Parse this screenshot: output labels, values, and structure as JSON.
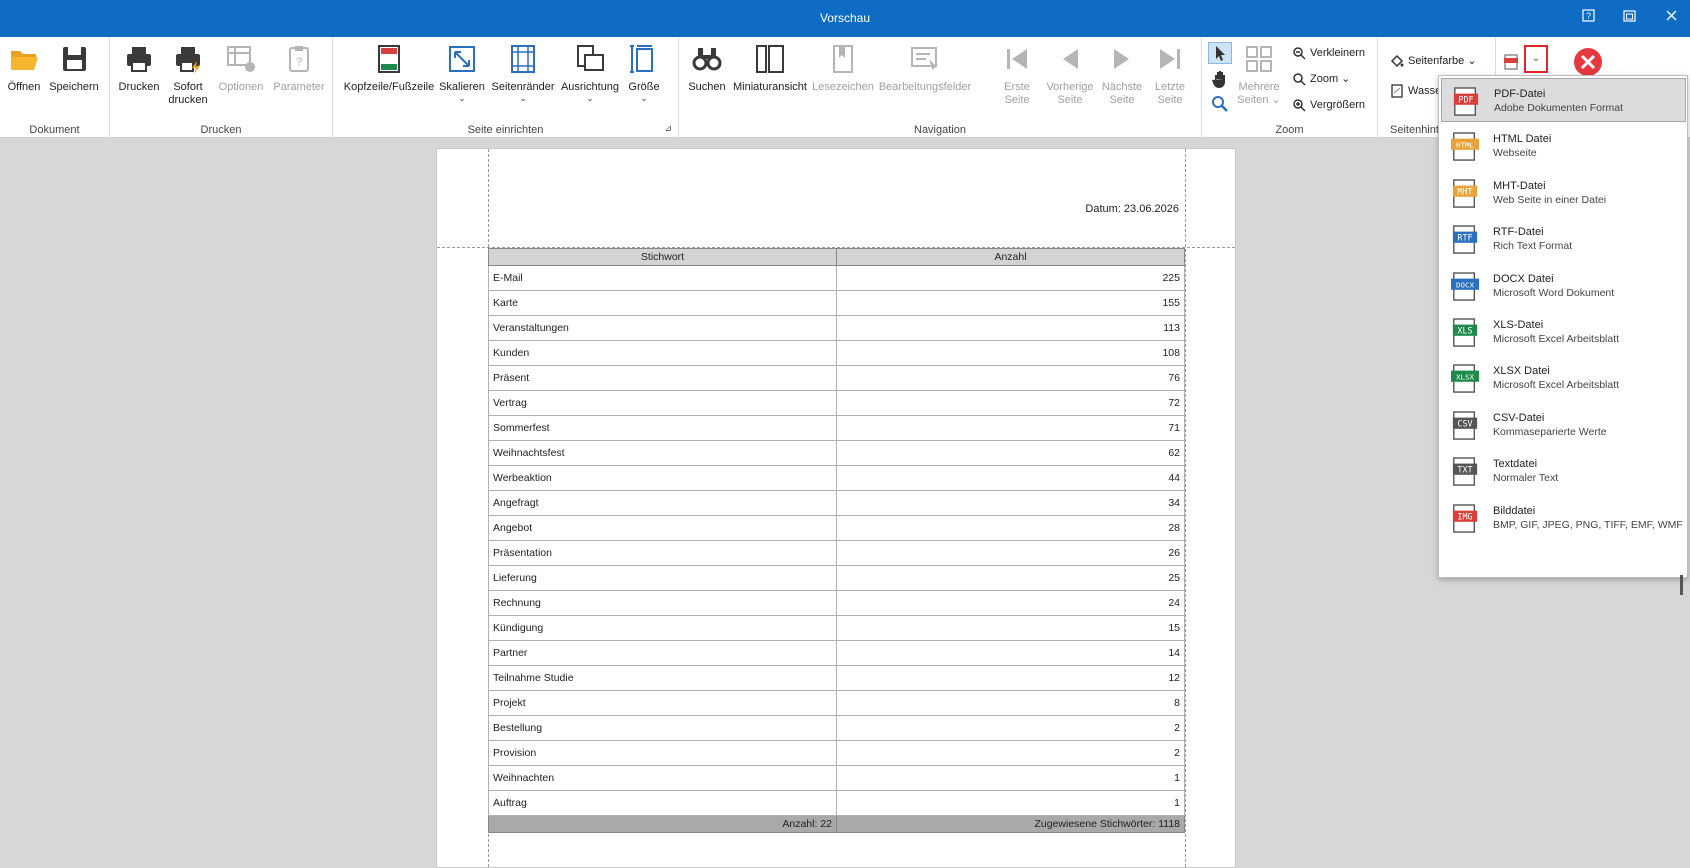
{
  "window": {
    "title": "Vorschau"
  },
  "ribbon": {
    "dokument": {
      "label": "Dokument",
      "open": "Öffnen",
      "save": "Speichern"
    },
    "drucken": {
      "label": "Drucken",
      "print": "Drucken",
      "quick_print_1": "Sofort",
      "quick_print_2": "drucken",
      "options": "Optionen",
      "parameters": "Parameter"
    },
    "seite": {
      "label": "Seite einrichten",
      "header_footer": "Kopfzeile/Fußzeile",
      "scale": "Skalieren",
      "margins": "Seitenränder",
      "orientation": "Ausrichtung",
      "size": "Größe"
    },
    "navigation": {
      "label": "Navigation",
      "search": "Suchen",
      "thumbnails": "Miniaturansicht",
      "bookmarks": "Lesezeichen",
      "edit_fields": "Bearbeitungsfelder",
      "first_1": "Erste",
      "first_2": "Seite",
      "prev_1": "Vorherige",
      "prev_2": "Seite",
      "next_1": "Nächste",
      "next_2": "Seite",
      "last_1": "Letzte",
      "last_2": "Seite"
    },
    "zoom": {
      "label": "Zoom",
      "multi_1": "Mehrere",
      "multi_2": "Seiten",
      "zoom_out": "Verkleinern",
      "zoom": "Zoom",
      "zoom_in": "Vergrößern"
    },
    "hintergrund": {
      "label": "Seitenhint",
      "page_color": "Seitenfarbe",
      "watermark": "Wasse"
    }
  },
  "report": {
    "date": "Datum: 23.06.2026",
    "headers": [
      "Stichwort",
      "Anzahl"
    ],
    "rows": [
      [
        "E-Mail",
        "225"
      ],
      [
        "Karte",
        "155"
      ],
      [
        "Veranstaltungen",
        "113"
      ],
      [
        "Kunden",
        "108"
      ],
      [
        "Präsent",
        "76"
      ],
      [
        "Vertrag",
        "72"
      ],
      [
        "Sommerfest",
        "71"
      ],
      [
        "Weihnachtsfest",
        "62"
      ],
      [
        "Werbeaktion",
        "44"
      ],
      [
        "Angefragt",
        "34"
      ],
      [
        "Angebot",
        "28"
      ],
      [
        "Präsentation",
        "26"
      ],
      [
        "Lieferung",
        "25"
      ],
      [
        "Rechnung",
        "24"
      ],
      [
        "Kündigung",
        "15"
      ],
      [
        "Partner",
        "14"
      ],
      [
        "Teilnahme Studie",
        "12"
      ],
      [
        "Projekt",
        "8"
      ],
      [
        "Bestellung",
        "2"
      ],
      [
        "Provision",
        "2"
      ],
      [
        "Weihnachten",
        "1"
      ],
      [
        "Auftrag",
        "1"
      ]
    ],
    "footer_left": "Anzahl: 22",
    "footer_right": "Zugewiesene Stichwörter: 1118"
  },
  "export_menu": [
    {
      "tag": "PDF",
      "color": "#d9403b",
      "title": "PDF-Datei",
      "sub": "Adobe Dokumenten Format"
    },
    {
      "tag": "HTML",
      "color": "#e8a33a",
      "title": "HTML Datei",
      "sub": "Webseite"
    },
    {
      "tag": "MHT",
      "color": "#e8a33a",
      "title": "MHT-Datei",
      "sub": "Web Seite in einer Datei"
    },
    {
      "tag": "RTF",
      "color": "#2a6fc0",
      "title": "RTF-Datei",
      "sub": "Rich Text Format"
    },
    {
      "tag": "DOCX",
      "color": "#2a6fc0",
      "title": "DOCX Datei",
      "sub": "Microsoft Word Dokument"
    },
    {
      "tag": "XLS",
      "color": "#1f8a4c",
      "title": "XLS-Datei",
      "sub": "Microsoft Excel Arbeitsblatt"
    },
    {
      "tag": "XLSX",
      "color": "#1f8a4c",
      "title": "XLSX Datei",
      "sub": "Microsoft Excel Arbeitsblatt"
    },
    {
      "tag": "CSV",
      "color": "#555555",
      "title": "CSV-Datei",
      "sub": "Kommaseparierte Werte"
    },
    {
      "tag": "TXT",
      "color": "#555555",
      "title": "Textdatei",
      "sub": "Normaler Text"
    },
    {
      "tag": "IMG",
      "color": "#d9403b",
      "title": "Bilddatei",
      "sub": "BMP, GIF, JPEG, PNG, TIFF, EMF, WMF"
    }
  ],
  "colors": {
    "titlebar": "#0f6cc4",
    "accent_red": "#e5383f"
  }
}
